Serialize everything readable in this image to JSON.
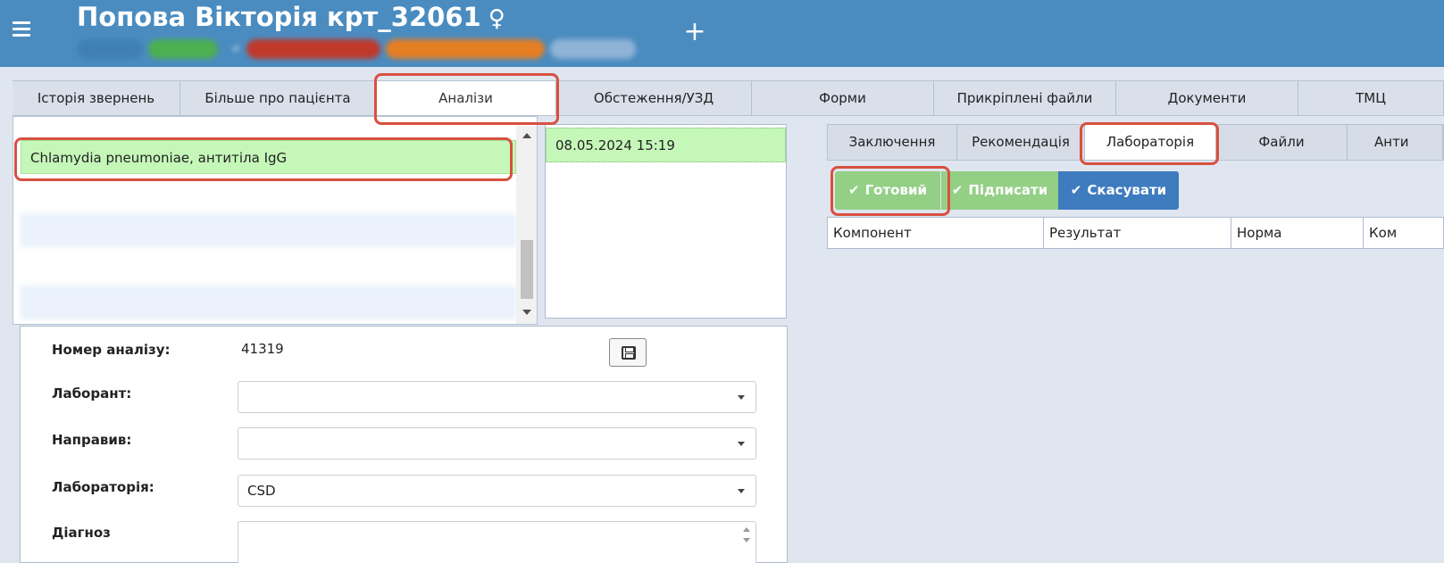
{
  "header": {
    "patient_name": "Попова Вікторія крт_32061",
    "gender_symbol": "♀",
    "badges": [
      "",
      "",
      "✔",
      "",
      "",
      ""
    ],
    "add_label": "+"
  },
  "main_tabs": [
    {
      "label": "Історія звернень"
    },
    {
      "label": "Більше про пацієнта"
    },
    {
      "label": "Аналізи"
    },
    {
      "label": "Обстеження/УЗД"
    },
    {
      "label": "Форми"
    },
    {
      "label": "Прикріплені файли"
    },
    {
      "label": "Документи"
    },
    {
      "label": "ТМЦ"
    }
  ],
  "analyses_list": {
    "items": [
      {
        "label": "Chlamydia pneumoniae, антитіла IgG",
        "blurred": false
      }
    ]
  },
  "dates": {
    "items": [
      "08.05.2024 15:19"
    ]
  },
  "form": {
    "number_label": "Номер аналізу:",
    "number_value": "41319",
    "lab_assistant_label": "Лаборант:",
    "referred_label": "Направив:",
    "laboratory_label": "Лабораторія:",
    "laboratory_value": "CSD",
    "diagnosis_label": "Діагноз"
  },
  "sub_tabs": [
    {
      "label": "Заключення"
    },
    {
      "label": "Рекомендація"
    },
    {
      "label": "Лабораторія"
    },
    {
      "label": "Файли"
    },
    {
      "label": "Анти"
    }
  ],
  "actions": {
    "ready_label": "Готовий",
    "sign_label": "Підписати",
    "cancel_label": "Скасувати"
  },
  "results_table": {
    "columns": [
      "Компонент",
      "Результат",
      "Норма",
      "Ком"
    ]
  },
  "colors": {
    "header_bg": "#4a8cc0",
    "selected_row": "#c5f7b9",
    "highlight": "#d9503f",
    "cancel_button": "#3e7bbf",
    "ready_button": "#94cf86"
  }
}
